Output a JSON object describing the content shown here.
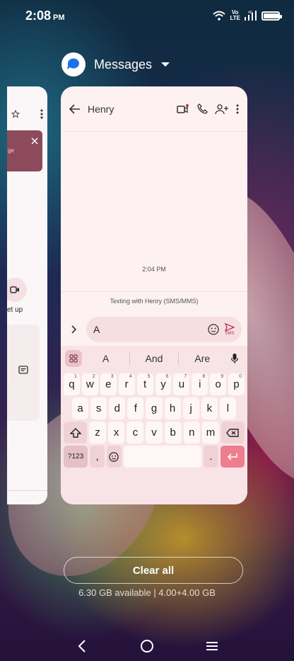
{
  "status_bar": {
    "time": "2:08",
    "ampm": "PM",
    "network_top": "Vo",
    "network_bottom": "LTE",
    "network_badge": "4G",
    "battery_level": 0.95
  },
  "recents": {
    "app_name": "Messages",
    "clear_all_label": "Clear all",
    "memory_info": "6.30 GB available | 4.00+4.00 GB"
  },
  "left_card": {
    "banner_text": "ge",
    "setup_label": "et up"
  },
  "conversation": {
    "contact_name": "Henry",
    "timestamp": "2:04 PM",
    "texting_info": "Texting with Henry (SMS/MMS)",
    "compose_value": "A",
    "send_sublabel": "SMS"
  },
  "keyboard": {
    "suggestions": [
      "A",
      "And",
      "Are"
    ],
    "row1": [
      {
        "k": "q",
        "n": "1"
      },
      {
        "k": "w",
        "n": "2"
      },
      {
        "k": "e",
        "n": "3"
      },
      {
        "k": "r",
        "n": "4"
      },
      {
        "k": "t",
        "n": "5"
      },
      {
        "k": "y",
        "n": "6"
      },
      {
        "k": "u",
        "n": "7"
      },
      {
        "k": "i",
        "n": "8"
      },
      {
        "k": "o",
        "n": "9"
      },
      {
        "k": "p",
        "n": "0"
      }
    ],
    "row2": [
      "a",
      "s",
      "d",
      "f",
      "g",
      "h",
      "j",
      "k",
      "l"
    ],
    "row3": [
      "z",
      "x",
      "c",
      "v",
      "b",
      "n",
      "m"
    ],
    "symbols_label": "?123",
    "comma": ",",
    "period": "."
  },
  "colors": {
    "accent": "#ee7d8f",
    "card_bg": "#fdf1f2",
    "keyboard_bg": "#f8e4e6"
  }
}
